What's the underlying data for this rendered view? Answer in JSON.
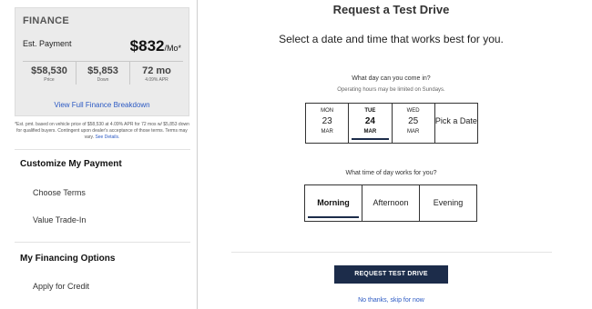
{
  "sidebar": {
    "finance": {
      "title": "FINANCE",
      "est_label": "Est. Payment",
      "est_amount": "$832",
      "est_unit": "/Mo*",
      "stats": [
        {
          "value": "$58,530",
          "label": "Price"
        },
        {
          "value": "$5,853",
          "label": "Down"
        },
        {
          "value": "72 mo",
          "label": "4.09% APR"
        }
      ],
      "breakdown_link": "View Full Finance Breakdown"
    },
    "disclaimer": "*Est. pmt. based on vehicle price of $58,530 at 4.09% APR for 72 mos w/ $5,853 down for qualified buyers. Contingent upon dealer's acceptance of those terms. Terms may vary.",
    "disclaimer_link": "See Details.",
    "customize_head": "Customize My Payment",
    "customize_items": [
      "Choose Terms",
      "Value Trade-In"
    ],
    "financing_head": "My Financing Options",
    "financing_items": [
      "Apply for Credit"
    ]
  },
  "main": {
    "title": "Request a Test Drive",
    "subtitle": "Select a date and time that works best for you.",
    "day_question": "What day can you come in?",
    "day_note": "Operating hours may be limited on Sundays.",
    "dates": [
      {
        "dow": "MON",
        "num": "23",
        "mon": "MAR"
      },
      {
        "dow": "TUE",
        "num": "24",
        "mon": "MAR"
      },
      {
        "dow": "WED",
        "num": "25",
        "mon": "MAR"
      }
    ],
    "pick_date": "Pick a Date",
    "time_question": "What time of day works for you?",
    "times": [
      "Morning",
      "Afternoon",
      "Evening"
    ],
    "cta": "REQUEST TEST DRIVE",
    "skip": "No thanks, skip for now"
  }
}
